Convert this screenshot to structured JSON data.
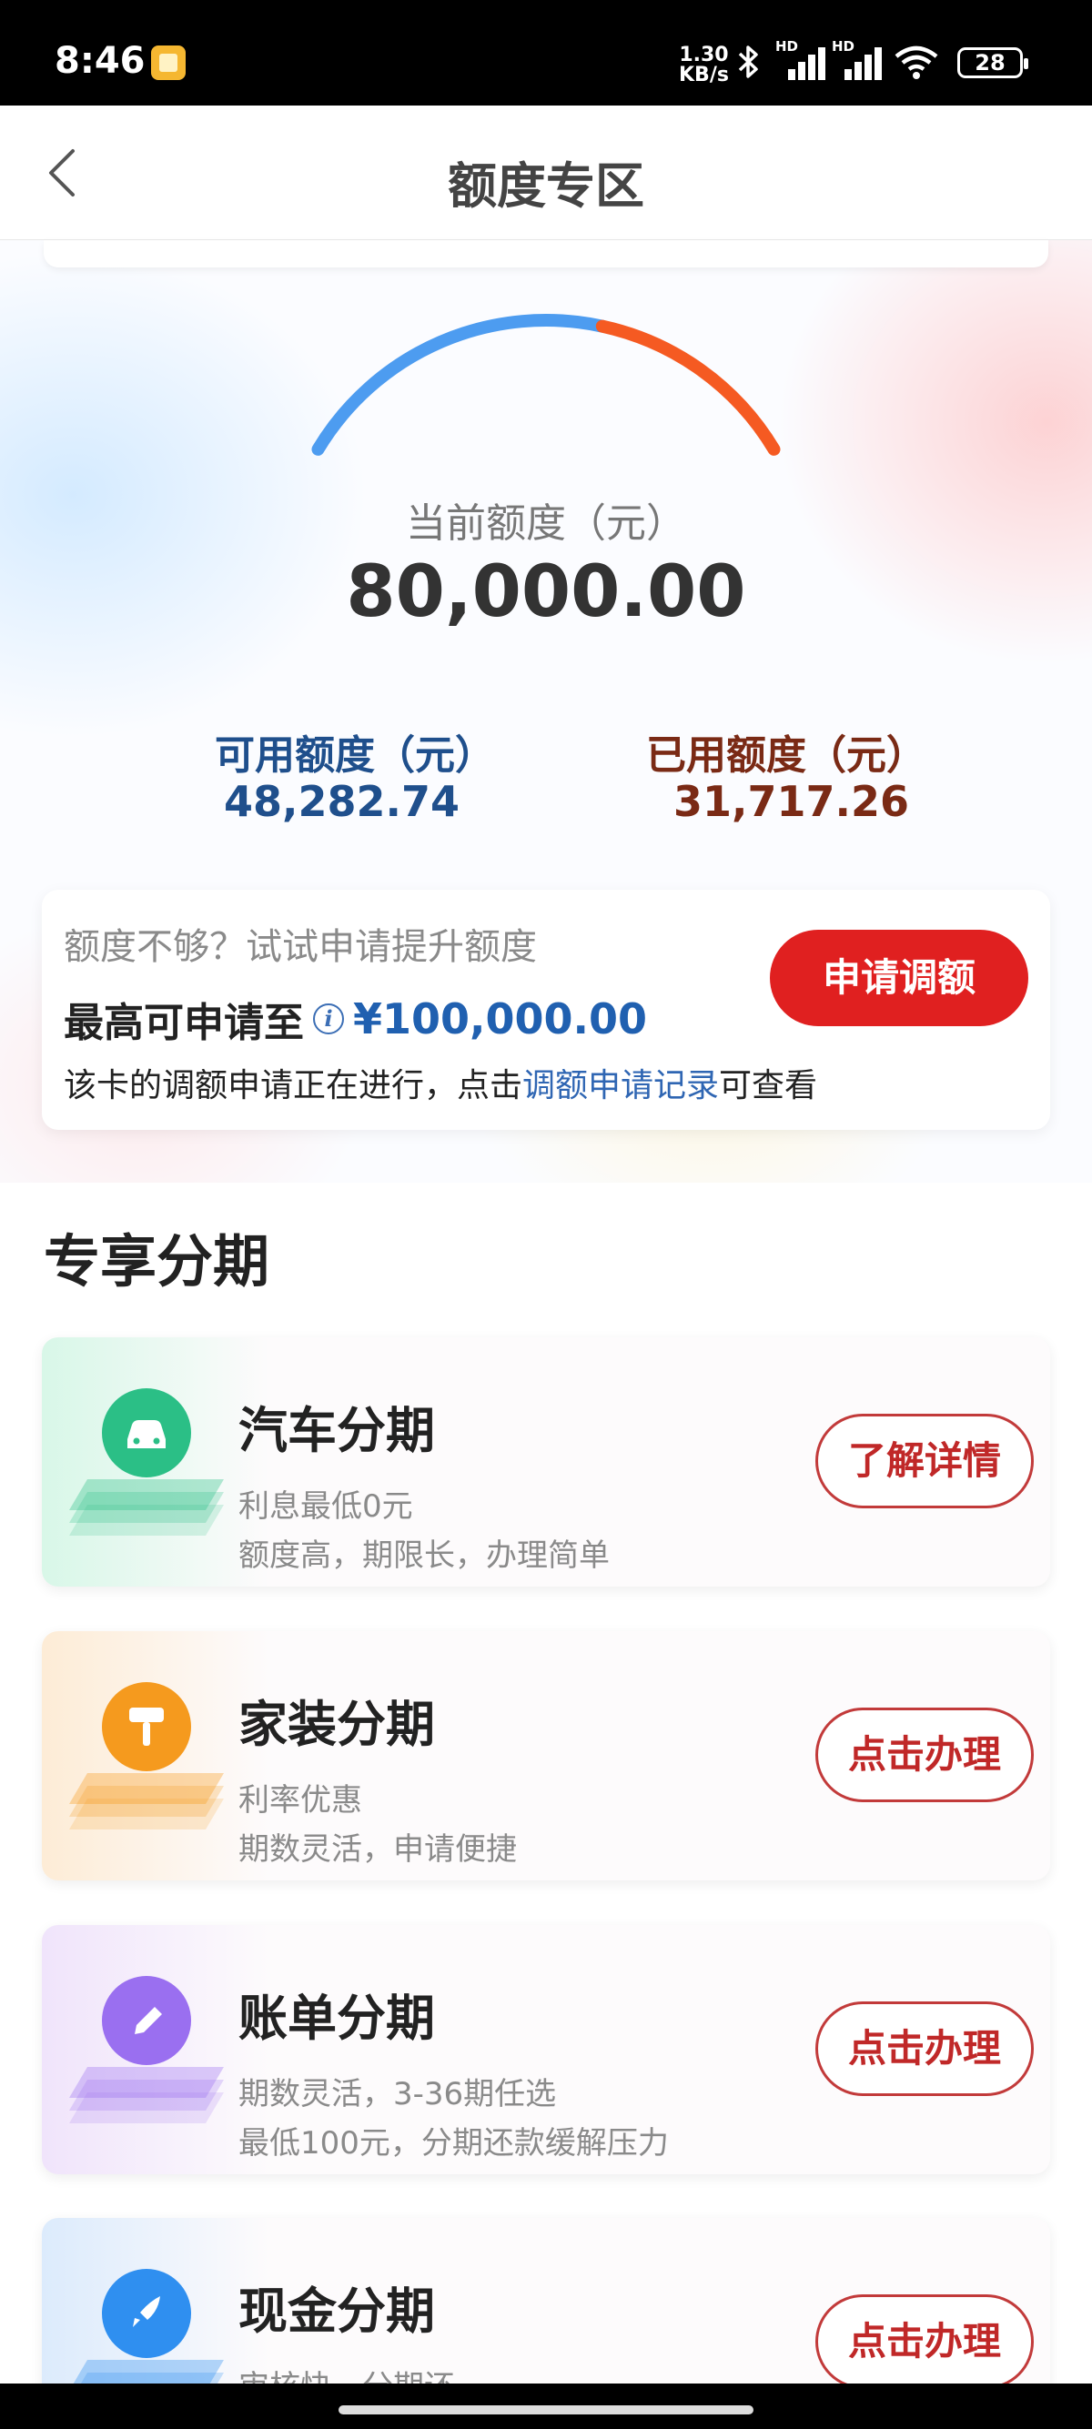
{
  "status_bar": {
    "time": "8:46",
    "speed_value": "1.30",
    "speed_unit": "KB/s",
    "sim_tag": "HD",
    "battery": "28"
  },
  "header": {
    "title": "额度专区"
  },
  "credit": {
    "current_label": "当前额度（元）",
    "current_value": "80,000.00",
    "available_label": "可用额度（元）",
    "available_value": "48,282.74",
    "used_label": "已用额度（元）",
    "used_value": "31,717.26",
    "used_fraction": 0.3965,
    "gauge_colors": {
      "available": "#4d9cf0",
      "used": "#f55a22"
    }
  },
  "raise": {
    "question": "额度不够？试试申请提升额度",
    "max_prefix": "最高可申请至",
    "info_glyph": "i",
    "max_amount": "¥100,000.00",
    "note_before": "该卡的调额申请正在进行，点击",
    "note_link": "调额申请记录",
    "note_after": "可查看",
    "button": "申请调额"
  },
  "installments": {
    "title": "专享分期",
    "items": [
      {
        "title": "汽车分期",
        "desc1": "利息最低0元",
        "desc2": "额度高，期限长，办理简单",
        "button": "了解详情",
        "icon": "car-icon",
        "color": "#2bbf86",
        "wash": "#d8f7e8"
      },
      {
        "title": "家装分期",
        "desc1": "利率优惠",
        "desc2": "期数灵活，申请便捷",
        "button": "点击办理",
        "icon": "paint-roller-icon",
        "color": "#f59a1e",
        "wash": "#fdecd6"
      },
      {
        "title": "账单分期",
        "desc1": "期数灵活，3-36期任选",
        "desc2": "最低100元，分期还款缓解压力",
        "button": "点击办理",
        "icon": "pencil-icon",
        "color": "#9a6ff0",
        "wash": "#f0e4fb"
      },
      {
        "title": "现金分期",
        "desc1": "审核快，分期还",
        "desc2": "",
        "button": "点击办理",
        "icon": "rocket-icon",
        "color": "#2f8ff0",
        "wash": "#dcebfc"
      }
    ]
  }
}
